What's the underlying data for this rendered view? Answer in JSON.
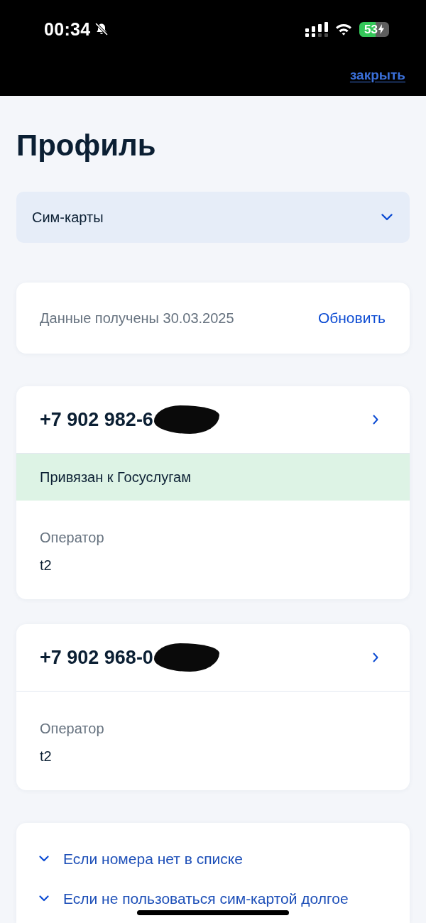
{
  "status_bar": {
    "time": "00:34",
    "silent": true,
    "battery": "53",
    "charging": true
  },
  "header": {
    "close_link": "закрыть"
  },
  "page": {
    "title": "Профиль"
  },
  "section_select": {
    "value": "Сим-карты"
  },
  "data_info": {
    "text": "Данные получены 30.03.2025",
    "action": "Обновить"
  },
  "sim_cards": [
    {
      "number": "+7 902 982-6",
      "redacted": true,
      "linked_label": "Привязан к Госуслугам",
      "operator_label": "Оператор",
      "operator": "t2"
    },
    {
      "number": "+7 902 968-0",
      "redacted": true,
      "operator_label": "Оператор",
      "operator": "t2"
    }
  ],
  "faq": [
    {
      "title": "Если номера нет в списке",
      "expanded": false
    },
    {
      "title": "Если не пользоваться сим-картой долгое",
      "expanded": false
    }
  ]
}
